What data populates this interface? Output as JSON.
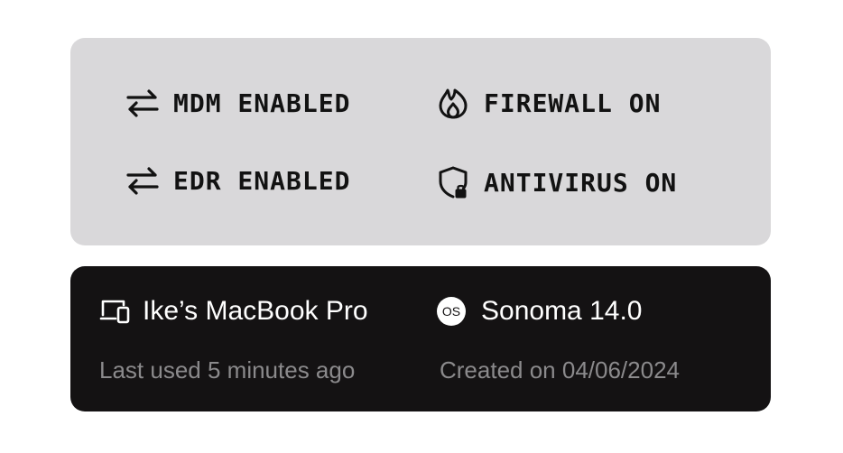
{
  "status_card": {
    "items": [
      {
        "label": "MDM ENABLED",
        "icon": "arrows-swap-icon"
      },
      {
        "label": "FIREWALL ON",
        "icon": "flame-icon"
      },
      {
        "label": "EDR ENABLED",
        "icon": "arrows-swap-icon"
      },
      {
        "label": "ANTIVIRUS ON",
        "icon": "shield-lock-icon"
      }
    ]
  },
  "device_card": {
    "device_name": "Ike’s MacBook Pro",
    "device_icon": "devices-icon",
    "os_badge": "OS",
    "os_version": "Sonoma 14.0",
    "last_used": "Last used 5 minutes ago",
    "created_on": "Created on 04/06/2024"
  },
  "colors": {
    "status_bg": "#d9d8da",
    "device_bg": "#141213",
    "subtext": "#8b8a8c"
  }
}
